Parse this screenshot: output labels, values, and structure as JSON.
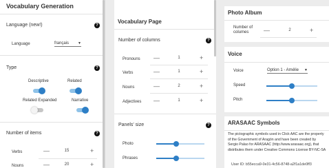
{
  "vocab_gen": {
    "title": "Vocabulary Generation",
    "language_section": "Language (new!)",
    "language_label": "Language",
    "language_value": "français",
    "type_section": "Type",
    "toggles": [
      {
        "label": "Descriptive",
        "on": true
      },
      {
        "label": "Related",
        "on": true
      },
      {
        "label": "Related Expanded",
        "on": false
      },
      {
        "label": "Narrative",
        "on": true
      }
    ],
    "items_section": "Number of items",
    "items": [
      {
        "label": "Verbs",
        "value": "15"
      },
      {
        "label": "Nouns",
        "value": "20"
      }
    ]
  },
  "vocab_page": {
    "title": "Vocabulary Page",
    "columns_section": "Number of columns",
    "columns": [
      {
        "label": "Pronouns",
        "value": "1"
      },
      {
        "label": "Verbs",
        "value": "1"
      },
      {
        "label": "Nouns",
        "value": "2"
      },
      {
        "label": "Adjectives",
        "value": "1"
      }
    ],
    "panels_section": "Panels' size",
    "panels": [
      {
        "label": "Photo",
        "level": 0.42
      },
      {
        "label": "Phrases",
        "level": 0.42
      }
    ]
  },
  "photo_album": {
    "title": "Photo Album",
    "columns_label_1": "Number of",
    "columns_label_2": "columes",
    "columns_value": "2"
  },
  "voice": {
    "title": "Voice",
    "voice_label": "Voice",
    "voice_value": "Option 1 - Amélie",
    "speed_label": "Speed",
    "speed_level": 0.5,
    "pitch_label": "Pitch",
    "pitch_level": 0.5
  },
  "arasaac": {
    "title": "ARASAAC Symbols",
    "text": "The pictographic symbols used in Click AAC are the property of the Government of Aragón and have been created by Sergio Palao for ARASAAC (http://www.arasaac.org), that distributes them under Creative Commons License BY-NC-SA",
    "user_id": "User ID: b55ecca9-0e31-4c56-8748-a2f1a1de0ff3"
  },
  "icons": {
    "help": "?",
    "minus": "—",
    "plus": "+",
    "caret": "▼"
  },
  "colors": {
    "accent": "#2e7fc6",
    "track": "#b9d6ef",
    "background": "#ececec"
  }
}
